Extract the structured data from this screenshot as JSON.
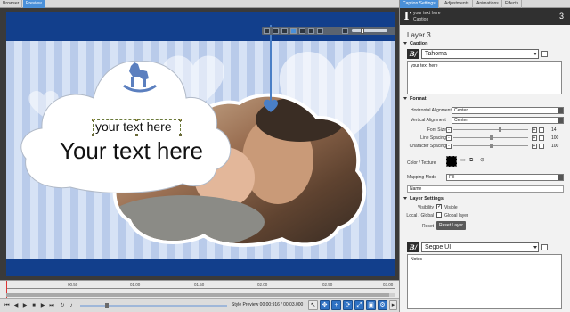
{
  "left_tabs": [
    {
      "label": "Browser",
      "active": false
    },
    {
      "label": "Preview",
      "active": true
    }
  ],
  "right_tabs": [
    {
      "label": "Caption Settings",
      "active": true
    },
    {
      "label": "Adjustments",
      "active": false
    },
    {
      "label": "Animations",
      "active": false
    },
    {
      "label": "Effects",
      "active": false
    }
  ],
  "layer_header": {
    "line1": "your text here",
    "line2": "Caption",
    "number": "3"
  },
  "stage": {
    "caption_small": "your text here",
    "caption_large": "Your text here"
  },
  "timeline": {
    "ticks": [
      "00.50",
      "01.00",
      "01.50",
      "02.00",
      "02.50",
      "03.00"
    ]
  },
  "transport": {
    "status": "Style Preview 00:00:916 / 00:03.000"
  },
  "panel": {
    "title": "Layer 3",
    "caption_section": "Caption",
    "caption_font": "Tahoma",
    "caption_text": "your text here",
    "format_section": "Format",
    "h_align_label": "Horizontal Alignment",
    "h_align_value": "Center",
    "v_align_label": "Vertical Alignment",
    "v_align_value": "Center",
    "font_size_label": "Font Size",
    "font_size_value": "14",
    "line_spacing_label": "Line Spacing",
    "line_spacing_value": "100",
    "char_spacing_label": "Character Spacing",
    "char_spacing_value": "100",
    "color_label": "Color / Texture",
    "mapping_label": "Mapping Mode",
    "mapping_value": "Fill",
    "name_placeholder": "Name",
    "layer_section": "Layer Settings",
    "visibility_label": "Visibility",
    "visible_label": "Visible",
    "local_global_label": "Local / Global",
    "global_layer_label": "Global layer",
    "reset_label": "Reset",
    "reset_button": "Reset Layer",
    "notes_font": "Segoe UI",
    "notes_text": "Notes"
  },
  "colors": {
    "accent": "#4a90d9",
    "navy_band": "#123f8c",
    "toolbar_blue": "#2f72c4"
  },
  "font_size_fraction": 0.62,
  "line_spacing_fraction": 0.5,
  "char_spacing_fraction": 0.5
}
